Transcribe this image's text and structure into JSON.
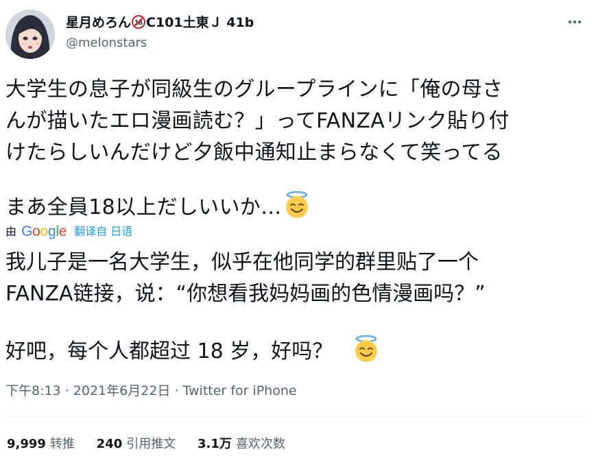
{
  "author": {
    "display_name_prefix": "星月めろん",
    "display_name_suffix": "C101土東Ｊ 41b",
    "badge_label": "18",
    "username": "@melonstars"
  },
  "tweet": {
    "lines": [
      "大学生の息子が同級生のグループラインに「俺の母さ",
      "んが描いたエロ漫画読む？」ってFANZAリンク貼り付",
      "けたらしいんだけど夕飯中通知止まらなくて笑ってる"
    ],
    "last_line": "まあ全員18以上だしいいか…"
  },
  "translation": {
    "by_label": "由",
    "provider": "Google",
    "link_label": "翻译自 日语",
    "lines": [
      "我儿子是一名大学生，似乎在他同学的群里贴了一个",
      "FANZA链接，说：“你想看我妈妈画的色情漫画吗？”"
    ],
    "last_line": "好吧，每个人都超过 18 岁，好吗？"
  },
  "meta": {
    "time": "下午8:13",
    "separator": " · ",
    "date": "2021年6月22日",
    "source": "Twitter for iPhone"
  },
  "stats": {
    "retweets_count": "9,999",
    "retweets_label": "转推",
    "quotes_count": "240",
    "quotes_label": "引用推文",
    "likes_count": "3.1万",
    "likes_label": "喜欢次数"
  },
  "icons": {
    "more": "more-dots-icon",
    "emoji": "smiling-face-with-halo-emoji",
    "badge": "age-18-restriction-icon"
  },
  "colors": {
    "text": "#0f1419",
    "secondary": "#536471",
    "link": "#1d9bf0",
    "divider": "#eff3f4"
  }
}
